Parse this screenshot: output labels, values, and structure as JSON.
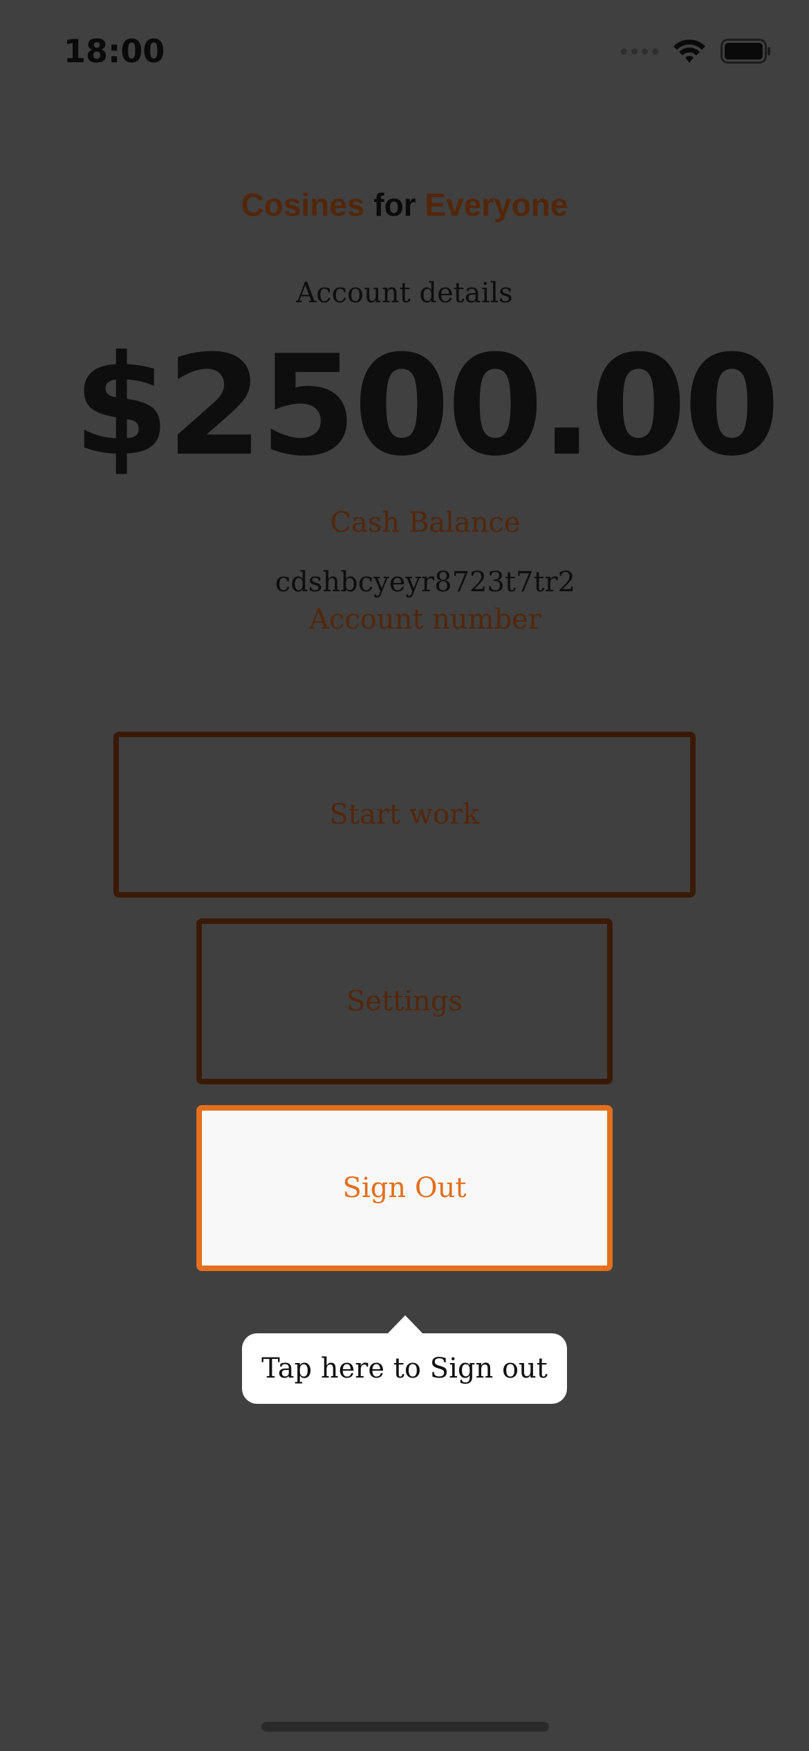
{
  "status_bar": {
    "time": "18:00",
    "icons": [
      "signal-icon",
      "wifi-icon",
      "battery-icon"
    ]
  },
  "app_title": {
    "part1": "Cosines",
    "part2": "for",
    "part3": "Everyone"
  },
  "account": {
    "heading": "Account details",
    "balance": "$2500.00",
    "balance_label": "Cash Balance",
    "number": "cdshbcyeyr8723t7tr2",
    "number_label": "Account number"
  },
  "buttons": {
    "start_work": "Start work",
    "settings": "Settings",
    "sign_out": "Sign Out"
  },
  "tooltip": {
    "text": "Tap here to Sign out"
  },
  "colors": {
    "background": "#404040",
    "accent": "#e46f1c",
    "dim_accent": "#53260a"
  }
}
